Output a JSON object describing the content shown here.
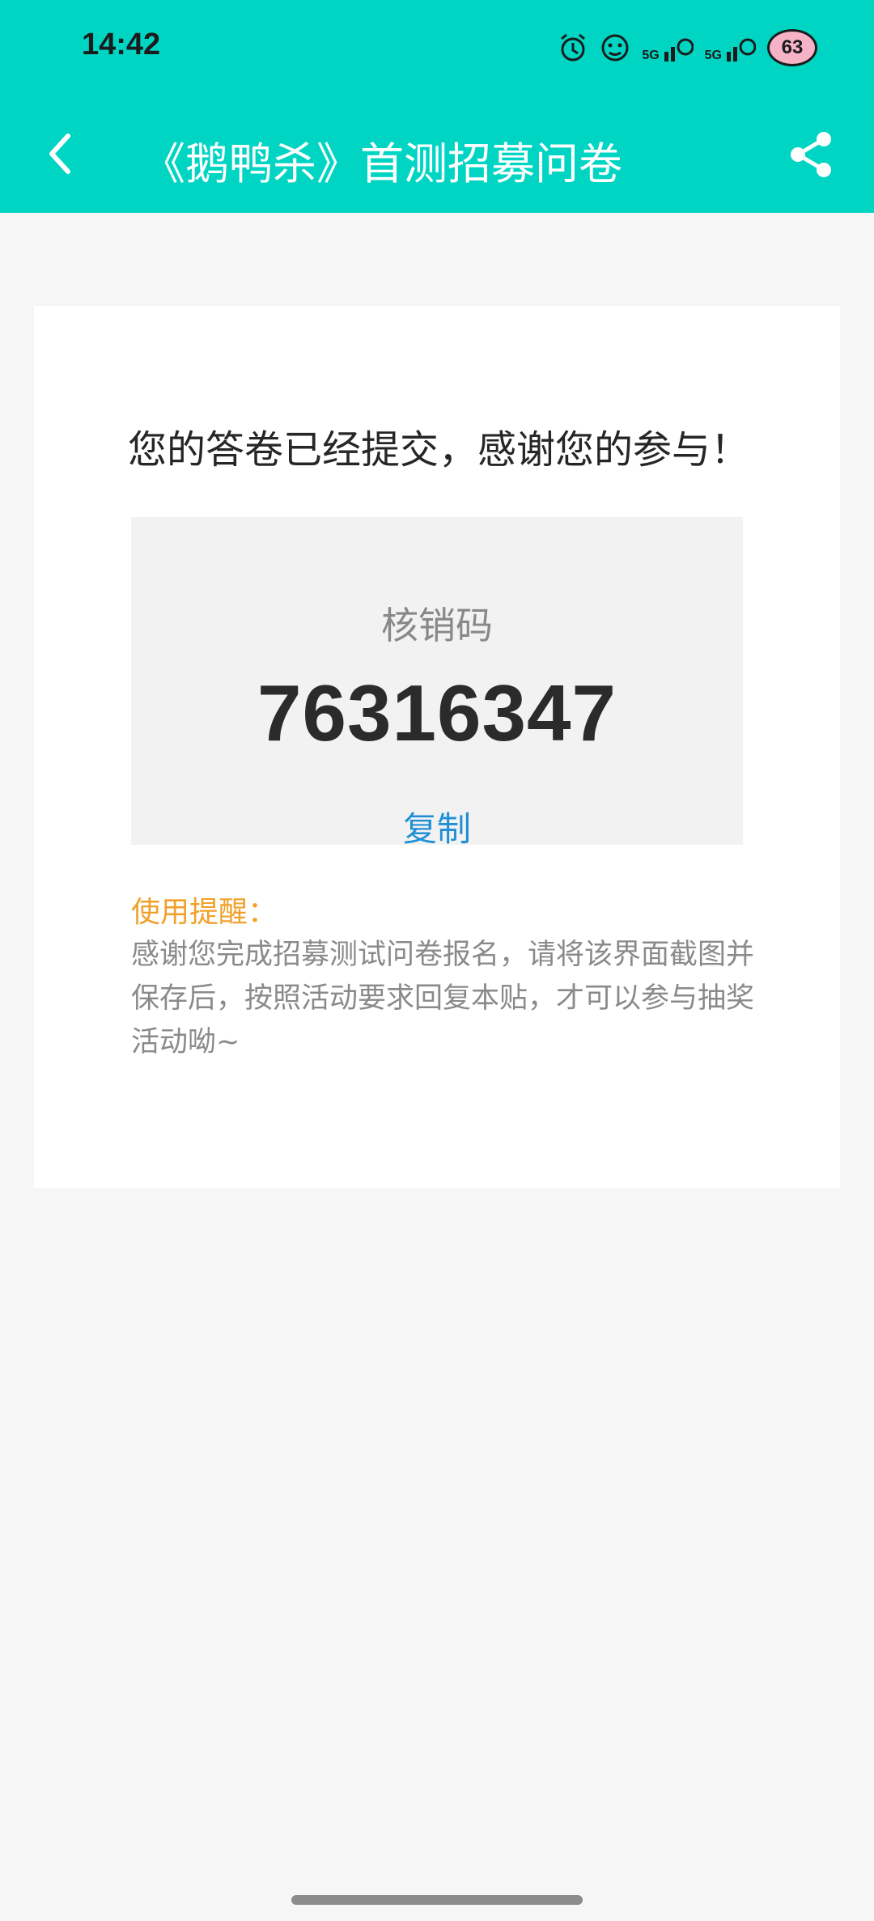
{
  "status_bar": {
    "time": "14:42",
    "network_1": "5G",
    "network_2": "5G",
    "battery": "63"
  },
  "nav": {
    "title": "《鹅鸭杀》首测招募问卷"
  },
  "card": {
    "success_message": "您的答卷已经提交，感谢您的参与！",
    "code_label": "核销码",
    "code_value": "76316347",
    "copy_label": "复制",
    "reminder_title": "使用提醒：",
    "reminder_text": "感谢您完成招募测试问卷报名，请将该界面截图并保存后，按照活动要求回复本贴，才可以参与抽奖活动呦~"
  },
  "colors": {
    "header_bg": "#00d5c4",
    "accent_blue": "#1f8fd6",
    "reminder_orange": "#f0a12b"
  }
}
